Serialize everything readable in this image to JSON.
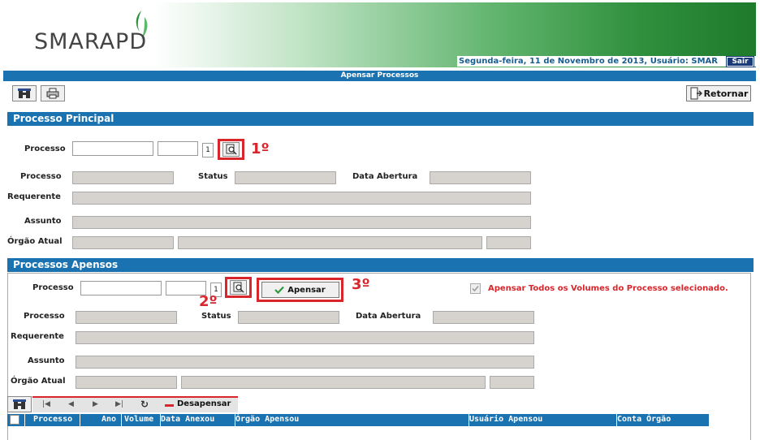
{
  "header": {
    "logo": "SMARAPD",
    "user_info": "Segunda-feira, 11 de Novembro de 2013, Usuário: SMAR",
    "logout": "Sair"
  },
  "page_title": "Apensar Processos",
  "toolbar": {
    "return_label": "Retornar"
  },
  "principal": {
    "section_title": "Processo Principal",
    "processo_label": "Processo",
    "volume_value": "1",
    "step_label": "1º",
    "fields": {
      "processo": "Processo",
      "status": "Status",
      "data_abertura": "Data Abertura",
      "requerente": "Requerente",
      "assunto": "Assunto",
      "orgao_atual": "Órgão Atual"
    }
  },
  "apensos": {
    "section_title": "Processos Apensos",
    "processo_label": "Processo",
    "volume_value": "1",
    "step2_label": "2º",
    "step3_label": "3º",
    "apensar_label": "Apensar",
    "all_volumes_label": "Apensar Todos os Volumes do Processo selecionado.",
    "fields": {
      "processo": "Processo",
      "status": "Status",
      "data_abertura": "Data Abertura",
      "requerente": "Requerente",
      "assunto": "Assunto",
      "orgao_atual": "Órgão Atual"
    }
  },
  "grid": {
    "desapensar_label": "Desapensar",
    "columns": [
      "Processo",
      "Ano",
      "Volume",
      "Data Anexou",
      "Órgão Apensou",
      "Usuário Apensou",
      "Conta Órgão"
    ]
  },
  "colors": {
    "section_blue": "#1a72b0",
    "highlight_red": "#d9262c",
    "readonly_gray": "#d6d3ce"
  }
}
